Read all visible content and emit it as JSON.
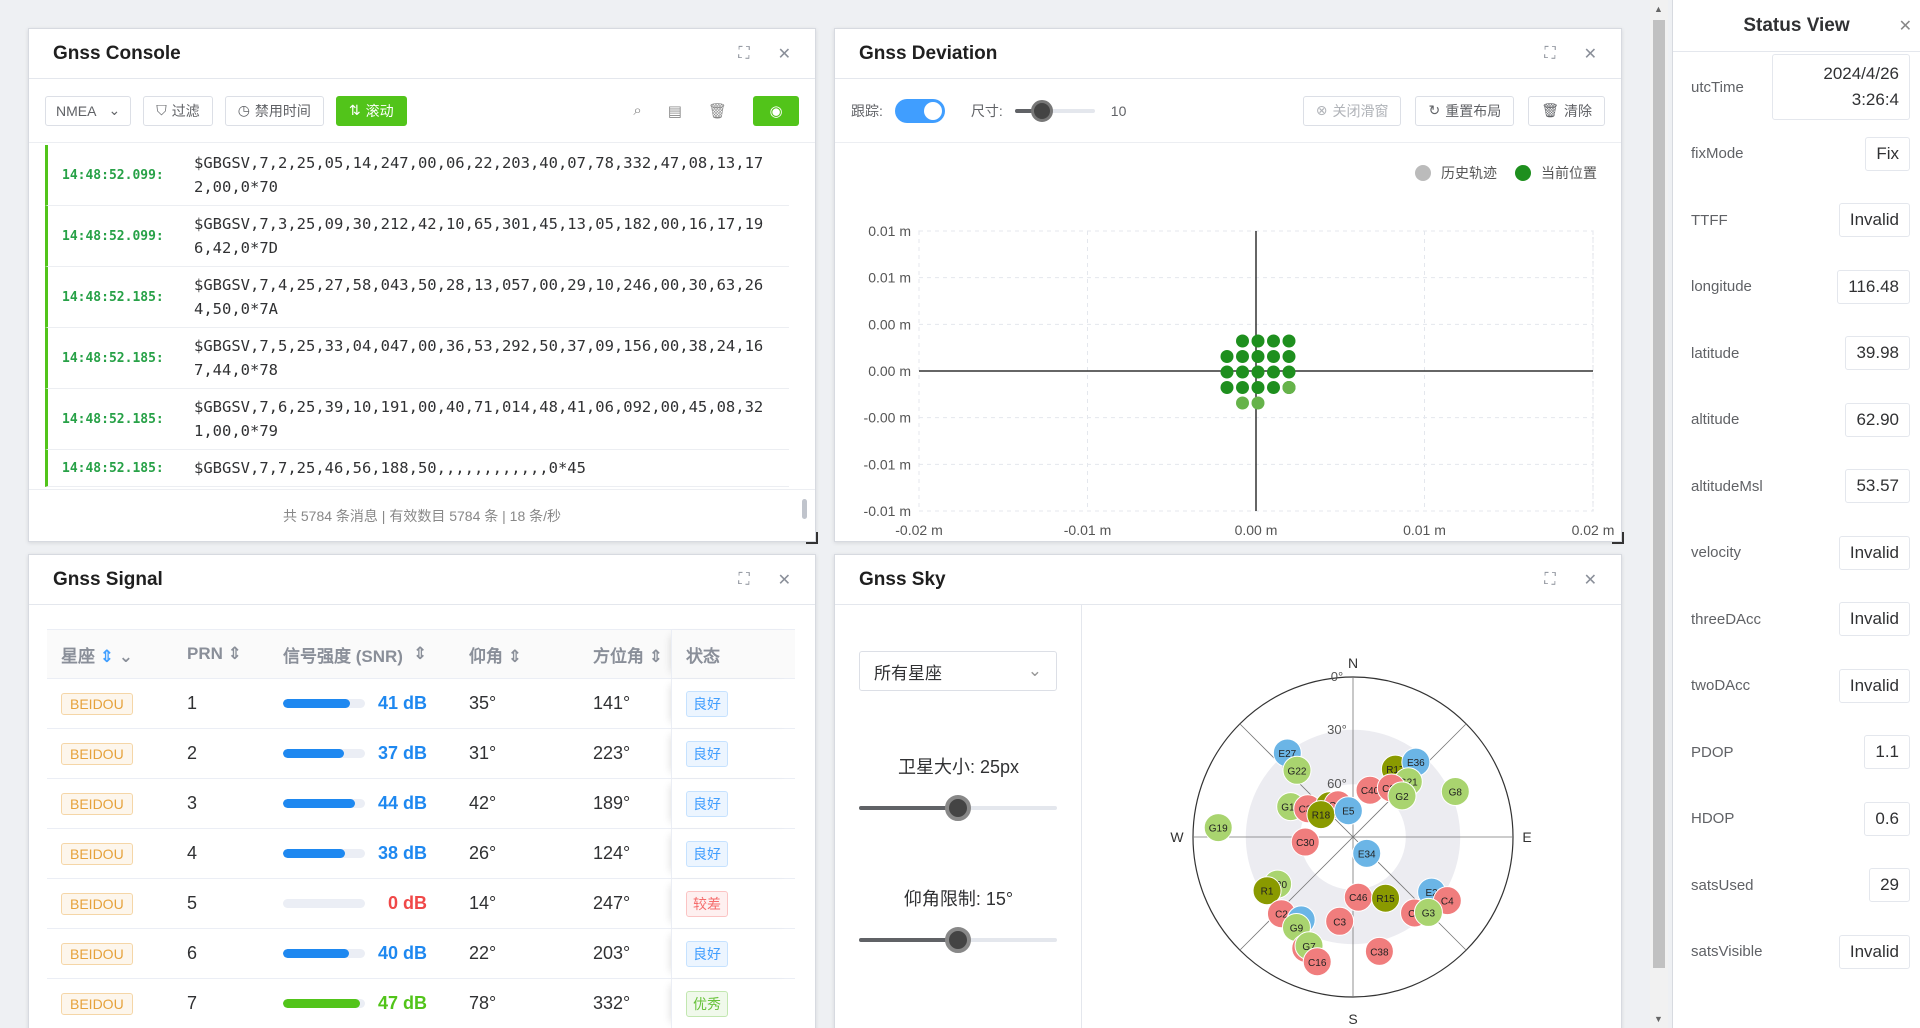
{
  "console": {
    "title": "Gnss Console",
    "toolbar": {
      "protocol": "NMEA",
      "filter": "过滤",
      "disable_time": "禁用时间",
      "scroll": "滚动"
    },
    "logs": [
      {
        "time": "14:48:52.099:",
        "msg": "$GBGSV,7,2,25,05,14,247,00,06,22,203,40,07,78,332,47,08,13,172,00,0*70"
      },
      {
        "time": "14:48:52.099:",
        "msg": "$GBGSV,7,3,25,09,30,212,42,10,65,301,45,13,05,182,00,16,17,196,42,0*7D"
      },
      {
        "time": "14:48:52.185:",
        "msg": "$GBGSV,7,4,25,27,58,043,50,28,13,057,00,29,10,246,00,30,63,264,50,0*7A"
      },
      {
        "time": "14:48:52.185:",
        "msg": "$GBGSV,7,5,25,33,04,047,00,36,53,292,50,37,09,156,00,38,24,167,44,0*78"
      },
      {
        "time": "14:48:52.185:",
        "msg": "$GBGSV,7,6,25,39,10,191,00,40,71,014,48,41,06,092,00,45,08,321,00,0*79"
      },
      {
        "time": "14:48:52.185:",
        "msg": "$GBGSV,7,7,25,46,56,188,50,,,,,,,,,,,,0*45"
      }
    ],
    "footer": "共 5784 条消息 | 有效数目 5784 条 | 18 条/秒"
  },
  "deviation": {
    "title": "Gnss Deviation",
    "track_label": "跟踪:",
    "size_label": "尺寸:",
    "size_value": "10",
    "close_slider": "关闭滑窗",
    "reset_layout": "重置布局",
    "clear": "清除",
    "legend_history": "历史轨迹",
    "legend_current": "当前位置",
    "y_ticks": [
      "0.01 m",
      "0.01 m",
      "0.00 m",
      "0.00 m",
      "-0.00 m",
      "-0.01 m",
      "-0.01 m"
    ],
    "x_ticks": [
      "-0.02 m",
      "-0.01 m",
      "0.00 m",
      "0.01 m",
      "0.02 m"
    ],
    "colors": {
      "history": "#66b34a",
      "current": "#1e8f1e"
    }
  },
  "signal": {
    "title": "Gnss Signal",
    "headers": [
      "星座",
      "PRN",
      "信号强度 (SNR)",
      "仰角",
      "方位角",
      "状态"
    ],
    "rows": [
      {
        "constellation": "BEIDOU",
        "prn": "1",
        "snr": 41,
        "snr_text": "41 dB",
        "elev": "35°",
        "azim": "141°",
        "status": "良好",
        "cls": "good"
      },
      {
        "constellation": "BEIDOU",
        "prn": "2",
        "snr": 37,
        "snr_text": "37 dB",
        "elev": "31°",
        "azim": "223°",
        "status": "良好",
        "cls": "good"
      },
      {
        "constellation": "BEIDOU",
        "prn": "3",
        "snr": 44,
        "snr_text": "44 dB",
        "elev": "42°",
        "azim": "189°",
        "status": "良好",
        "cls": "good"
      },
      {
        "constellation": "BEIDOU",
        "prn": "4",
        "snr": 38,
        "snr_text": "38 dB",
        "elev": "26°",
        "azim": "124°",
        "status": "良好",
        "cls": "good"
      },
      {
        "constellation": "BEIDOU",
        "prn": "5",
        "snr": 0,
        "snr_text": "0 dB",
        "elev": "14°",
        "azim": "247°",
        "status": "较差",
        "cls": "bad"
      },
      {
        "constellation": "BEIDOU",
        "prn": "6",
        "snr": 40,
        "snr_text": "40 dB",
        "elev": "22°",
        "azim": "203°",
        "status": "良好",
        "cls": "good"
      },
      {
        "constellation": "BEIDOU",
        "prn": "7",
        "snr": 47,
        "snr_text": "47 dB",
        "elev": "78°",
        "azim": "332°",
        "status": "优秀",
        "cls": "ex"
      }
    ],
    "colors": {
      "good": "#1e88f0",
      "bad": "#f04848",
      "ex": "#52c41a"
    }
  },
  "sky": {
    "title": "Gnss Sky",
    "constellation_select": "所有星座",
    "sat_size_label": "卫星大小: 25px",
    "sat_size_fraction": 0.5,
    "elev_limit_label": "仰角限制: 15°",
    "elev_limit_fraction": 0.5,
    "compass": [
      "N",
      "E",
      "S",
      "W"
    ],
    "rings": [
      "0°",
      "30°",
      "60°"
    ],
    "satellites": [
      {
        "id": "E27",
        "el": 30,
        "az": 322,
        "type": "gal"
      },
      {
        "id": "G22",
        "el": 41,
        "az": 320,
        "type": "gps"
      },
      {
        "id": "R17",
        "el": 45,
        "az": 32,
        "type": "glo"
      },
      {
        "id": "E36",
        "el": 35,
        "az": 40,
        "type": "gal"
      },
      {
        "id": "G21",
        "el": 46,
        "az": 45,
        "type": "gps"
      },
      {
        "id": "C40",
        "el": 62,
        "az": 20,
        "type": "bds"
      },
      {
        "id": "C27",
        "el": 55,
        "az": 38,
        "type": "bds"
      },
      {
        "id": "G2",
        "el": 54,
        "az": 50,
        "type": "gps"
      },
      {
        "id": "G8",
        "el": 27,
        "az": 66,
        "type": "gps"
      },
      {
        "id": "G17",
        "el": 51,
        "az": 296,
        "type": "gps"
      },
      {
        "id": "C36",
        "el": 60,
        "az": 302,
        "type": "bds"
      },
      {
        "id": "G46",
        "el": 68,
        "az": 323,
        "type": "glo"
      },
      {
        "id": "C46",
        "el": 70,
        "az": 335,
        "type": "bds"
      },
      {
        "id": "R18",
        "el": 68,
        "az": 305,
        "type": "glo"
      },
      {
        "id": "E5",
        "el": 75,
        "az": 350,
        "type": "gal"
      },
      {
        "id": "C30",
        "el": 63,
        "az": 264,
        "type": "bds"
      },
      {
        "id": "G19",
        "el": 14,
        "az": 274,
        "type": "gps"
      },
      {
        "id": "E34",
        "el": 78,
        "az": 140,
        "type": "gal"
      },
      {
        "id": "G30",
        "el": 40,
        "az": 238,
        "type": "gps"
      },
      {
        "id": "R1",
        "el": 33,
        "az": 238,
        "type": "glo"
      },
      {
        "id": "C2",
        "el": 31,
        "az": 223,
        "type": "bds"
      },
      {
        "id": "E5",
        "el": 35,
        "az": 212,
        "type": "gal"
      },
      {
        "id": "G9",
        "el": 30,
        "az": 212,
        "type": "gps"
      },
      {
        "id": "C6",
        "el": 22,
        "az": 203,
        "type": "bds"
      },
      {
        "id": "G7",
        "el": 24,
        "az": 202,
        "type": "gps"
      },
      {
        "id": "C16",
        "el": 17,
        "az": 196,
        "type": "bds"
      },
      {
        "id": "C3",
        "el": 42,
        "az": 189,
        "type": "bds"
      },
      {
        "id": "C46",
        "el": 56,
        "az": 175,
        "type": "bds"
      },
      {
        "id": "R15",
        "el": 51,
        "az": 152,
        "type": "glo"
      },
      {
        "id": "C38",
        "el": 24,
        "az": 167,
        "type": "bds"
      },
      {
        "id": "C1",
        "el": 35,
        "az": 141,
        "type": "bds"
      },
      {
        "id": "E2",
        "el": 36,
        "az": 125,
        "type": "gal"
      },
      {
        "id": "C4",
        "el": 26,
        "az": 124,
        "type": "bds"
      },
      {
        "id": "G3",
        "el": 30,
        "az": 135,
        "type": "gps"
      }
    ],
    "colors": {
      "gps": "#a9d46f",
      "bds": "#f07d7d",
      "gal": "#6bb5e6",
      "glo": "#8a9a00"
    }
  },
  "status": {
    "title": "Status View",
    "items": [
      {
        "key": "utcTime",
        "value": "2024/4/26 3:26:4"
      },
      {
        "key": "fixMode",
        "value": "Fix"
      },
      {
        "key": "TTFF",
        "value": "Invalid"
      },
      {
        "key": "longitude",
        "value": "116.48"
      },
      {
        "key": "latitude",
        "value": "39.98"
      },
      {
        "key": "altitude",
        "value": "62.90"
      },
      {
        "key": "altitudeMsl",
        "value": "53.57"
      },
      {
        "key": "velocity",
        "value": "Invalid"
      },
      {
        "key": "threeDAcc",
        "value": "Invalid"
      },
      {
        "key": "twoDAcc",
        "value": "Invalid"
      },
      {
        "key": "PDOP",
        "value": "1.1"
      },
      {
        "key": "HDOP",
        "value": "0.6"
      },
      {
        "key": "satsUsed",
        "value": "29"
      },
      {
        "key": "satsVisible",
        "value": "Invalid"
      }
    ]
  }
}
